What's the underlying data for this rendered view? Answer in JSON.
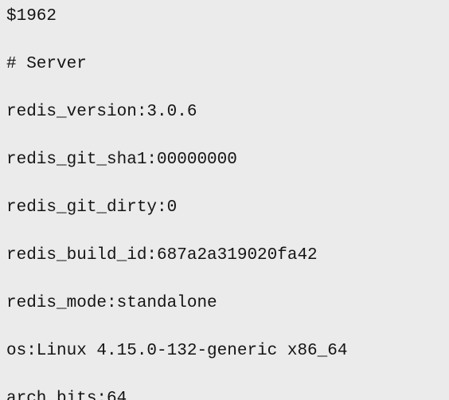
{
  "output": {
    "lines": [
      "$1962",
      "# Server",
      "redis_version:3.0.6",
      "redis_git_sha1:00000000",
      "redis_git_dirty:0",
      "redis_build_id:687a2a319020fa42",
      "redis_mode:standalone",
      "os:Linux 4.15.0-132-generic x86_64",
      "arch_bits:64"
    ]
  }
}
